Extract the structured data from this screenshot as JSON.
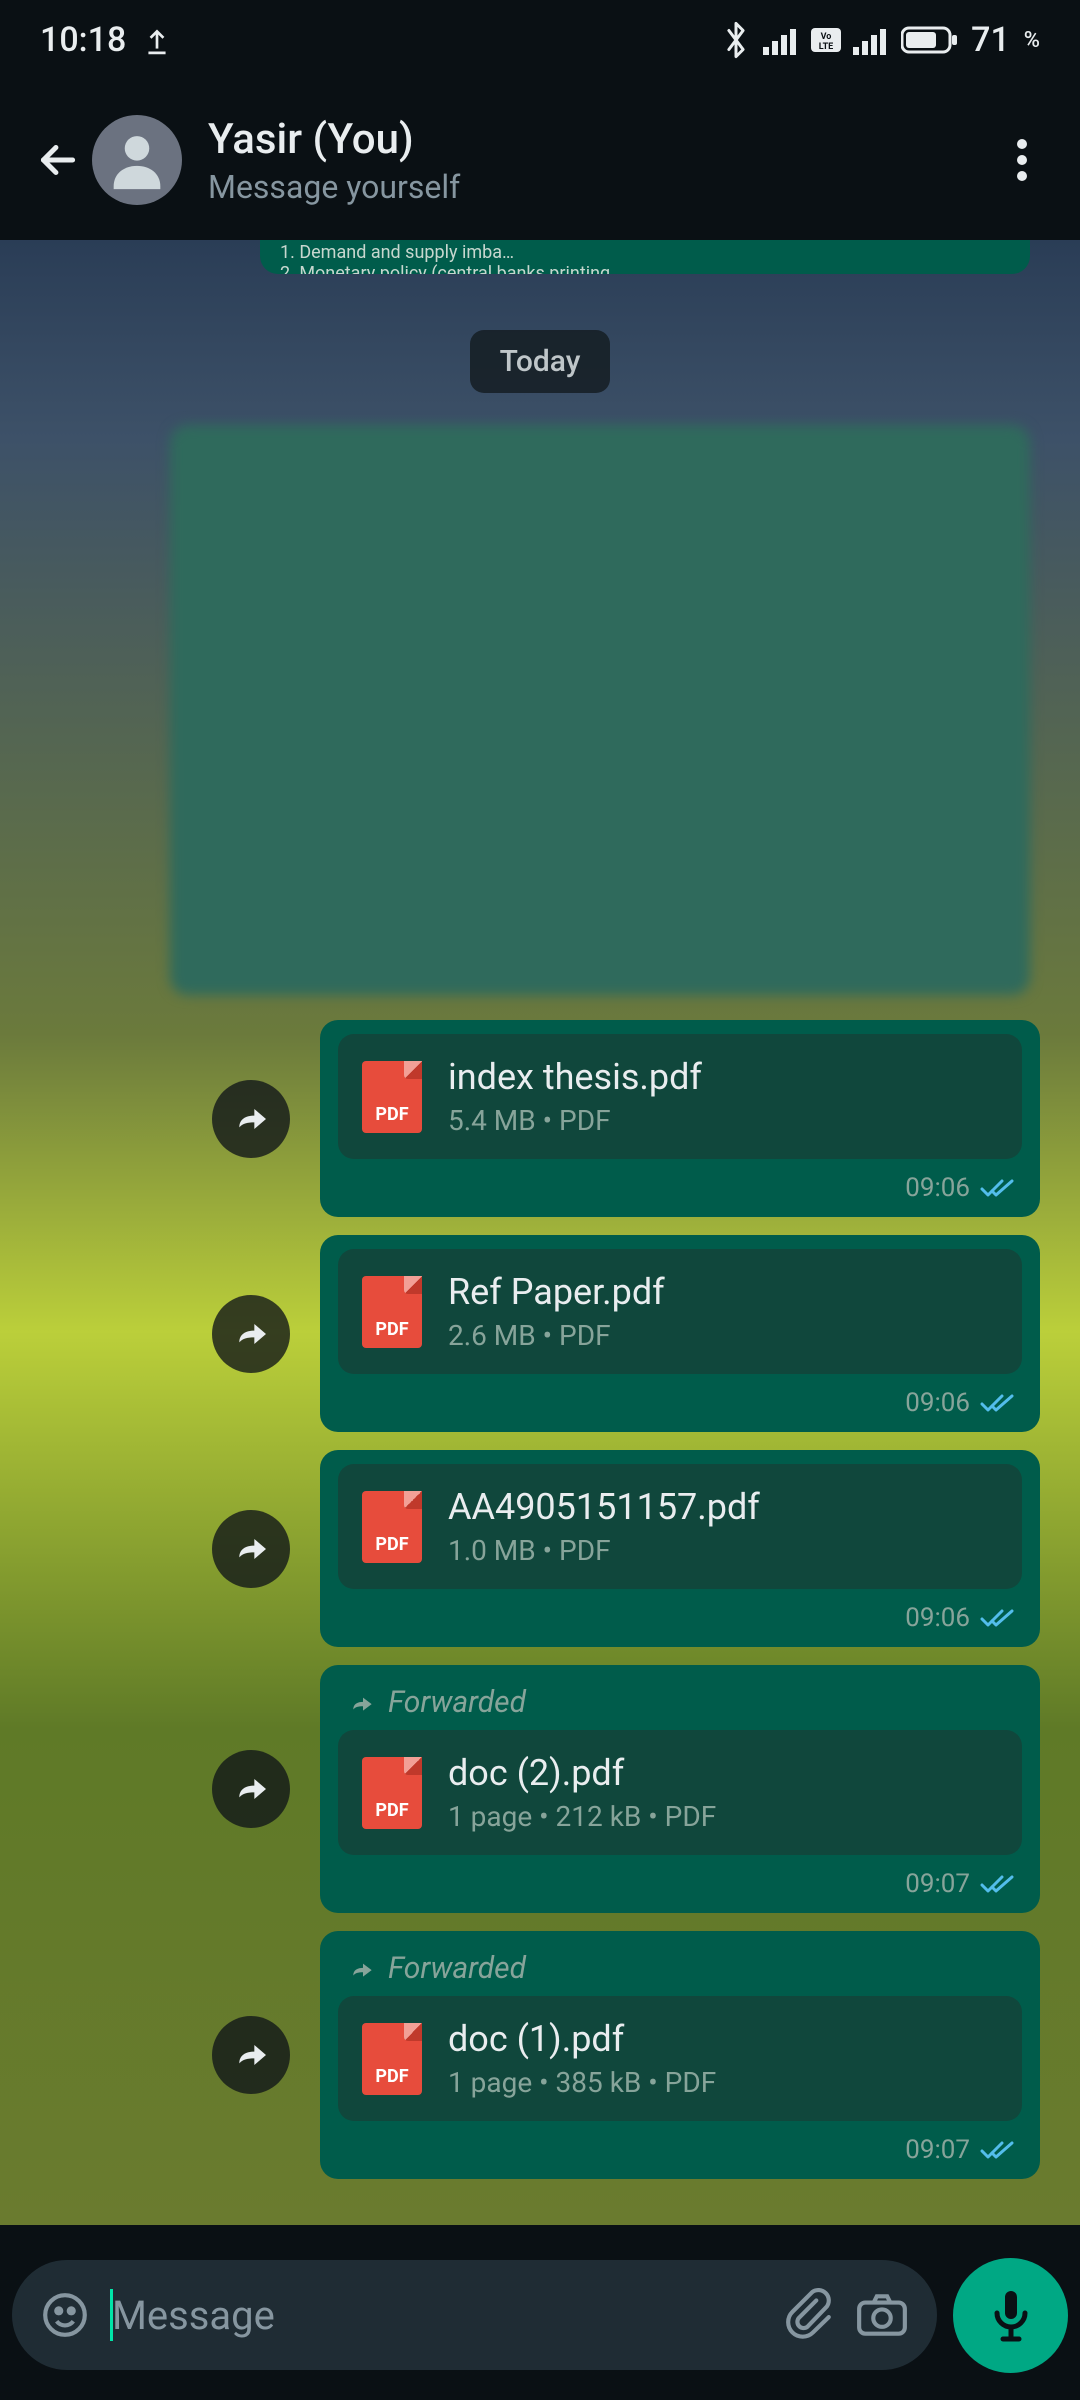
{
  "status": {
    "time": "10:18",
    "battery_pct": "71",
    "pct_sign": "%"
  },
  "header": {
    "title": "Yasir (You)",
    "subtitle": "Message yourself"
  },
  "chat": {
    "prev_line1": "1. Demand and supply imba…",
    "prev_line2": "2. Monetary policy (central banks printing",
    "date_chip": "Today",
    "forwarded_label": "Forwarded"
  },
  "messages": [
    {
      "name": "index thesis.pdf",
      "meta": "5.4 MB  •  PDF",
      "time": "09:06",
      "forwarded": false
    },
    {
      "name": "Ref Paper.pdf",
      "meta": "2.6 MB  •  PDF",
      "time": "09:06",
      "forwarded": false
    },
    {
      "name": "AA4905151157.pdf",
      "meta": "1.0 MB  •  PDF",
      "time": "09:06",
      "forwarded": false
    },
    {
      "name": "doc (2).pdf",
      "meta": "1 page  •  212 kB  •  PDF",
      "time": "09:07",
      "forwarded": true
    },
    {
      "name": "doc (1).pdf",
      "meta": "1 page  •  385 kB  •  PDF",
      "time": "09:07",
      "forwarded": true
    }
  ],
  "input": {
    "placeholder": "Message",
    "pdf_label": "PDF"
  }
}
